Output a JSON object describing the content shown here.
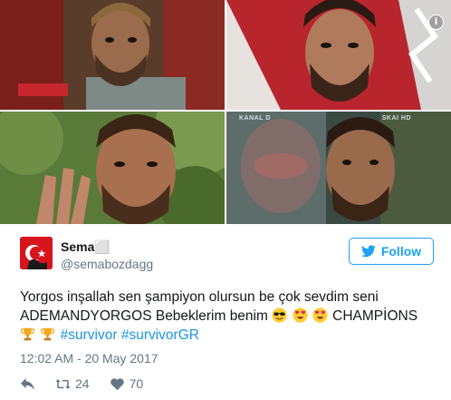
{
  "collage": {
    "images": [
      {
        "alt": "contestant-top-left"
      },
      {
        "alt": "contestant-top-right"
      },
      {
        "alt": "contestant-bottom-left"
      },
      {
        "alt": "contestant-bottom-right"
      }
    ],
    "info_glyph": "i",
    "tv_logo": "KANAL D",
    "tv_logo_2": "SKAI HD"
  },
  "tweet": {
    "author_name": "Sema⬜",
    "author_handle": "@semabozdagg",
    "follow_label": "Follow",
    "text_line1": "Yorgos inşallah sen şampiyon olursun be çok sevdim seni",
    "text_line2_prefix": "ADEMANDYORGOS Bebeklerim benim",
    "text_line2_suffix": "CHAMPİONS",
    "hashtag1": "#survivor",
    "hashtag2": "#survivorGR",
    "timestamp": "12:02 AM - 20 May 2017",
    "retweets": "24",
    "likes": "70"
  },
  "colors": {
    "twitter_blue": "#1da1f2",
    "link_blue": "#1b95e0",
    "muted_gray": "#657786",
    "text_dark": "#14171a",
    "avatar_red": "#d8141d"
  },
  "icons": {
    "follow": "twitter-bird-icon",
    "reply": "reply-icon",
    "retweet": "retweet-icon",
    "like": "heart-icon",
    "emojis": [
      "sunglasses-emoji",
      "heart-eyes-emoji",
      "heart-eyes-emoji",
      "trophy-emoji",
      "trophy-emoji"
    ]
  }
}
